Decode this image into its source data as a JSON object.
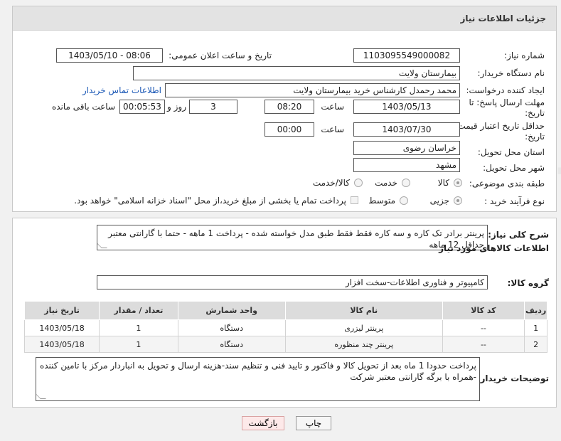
{
  "header": {
    "title": "جزئیات اطلاعات نیاز"
  },
  "form": {
    "need_number": {
      "label": "شماره نیاز:",
      "value": "1103095549000082"
    },
    "announce": {
      "label": "تاریخ و ساعت اعلان عمومی:",
      "value": "1403/05/10 - 08:06"
    },
    "buyer_org": {
      "label": "نام دستگاه خریدار:",
      "value": "بیمارستان ولایت"
    },
    "requester": {
      "label": "ایجاد کننده درخواست:",
      "value": "محمد رحمدل کارشناس خرید بیمارستان ولایت",
      "contact_link": "اطلاعات تماس خریدار"
    },
    "reply_deadline": {
      "label_line1": "مهلت ارسال پاسخ: تا",
      "label_line2": "تاریخ:",
      "date": "1403/05/13",
      "time_label": "ساعت",
      "time": "08:20",
      "days": "3",
      "days_label": "روز و",
      "remaining": "00:05:53",
      "remaining_label": "ساعت باقی مانده"
    },
    "price_validity": {
      "label_line1": "حداقل تاریخ اعتبار قیمت: تا",
      "label_line2": "تاریخ:",
      "date": "1403/07/30",
      "time_label": "ساعت",
      "time": "00:00"
    },
    "province": {
      "label": "استان محل تحویل:",
      "value": "خراسان رضوی"
    },
    "city": {
      "label": "شهر محل تحویل:",
      "value": "مشهد"
    },
    "category": {
      "label": "طبقه بندی موضوعی:",
      "options": [
        "کالا",
        "خدمت",
        "کالا/خدمت"
      ],
      "selected": "کالا"
    },
    "process": {
      "label": "نوع فرآیند خرید :",
      "options": [
        "جزیی",
        "متوسط"
      ],
      "selected": "جزیی",
      "treasury_note": "پرداخت تمام یا بخشی از مبلغ خرید،از محل \"اسناد خزانه اسلامی\" خواهد بود."
    }
  },
  "details": {
    "summary_label": "شرح کلی نیاز:",
    "summary": "پرینتر برادر تک کاره و سه کاره فقط فقط طبق مدل خواسته شده - پرداخت 1 ماهه - حتما با گارانتی معتبر حداقل 12 ماهه",
    "goods_info_title": "اطلاعات کالاهای مورد نیاز",
    "goods_group_label": "گروه کالا:",
    "goods_group": "کامپیوتر و فناوری اطلاعات-سخت افزار",
    "table": {
      "headers": [
        "ردیف",
        "کد کالا",
        "نام کالا",
        "واحد شمارش",
        "تعداد / مقدار",
        "تاریخ نیاز"
      ],
      "rows": [
        [
          "1",
          "--",
          "پرینتر لیزری",
          "دستگاه",
          "1",
          "1403/05/18"
        ],
        [
          "2",
          "--",
          "پرینتر چند منظوره",
          "دستگاه",
          "1",
          "1403/05/18"
        ]
      ]
    },
    "buyer_notes_label": "توضیحات خریدار:",
    "buyer_notes": "پرداخت حدودا 1 ماه بعد از تحویل کالا و فاکتور و تایید فنی و تنظیم سند-هزینه ارسال و تحویل به انباردار مرکز با تامین کننده -همراه با برگه گارانتی معتبر شرکت"
  },
  "buttons": {
    "print": "چاپ",
    "back": "بازگشت"
  },
  "watermark": "AriaTender.net",
  "colors": {
    "link": "#1a57b5",
    "header_bg": "#e3e3e3",
    "table_header": "#dcdcdc"
  }
}
